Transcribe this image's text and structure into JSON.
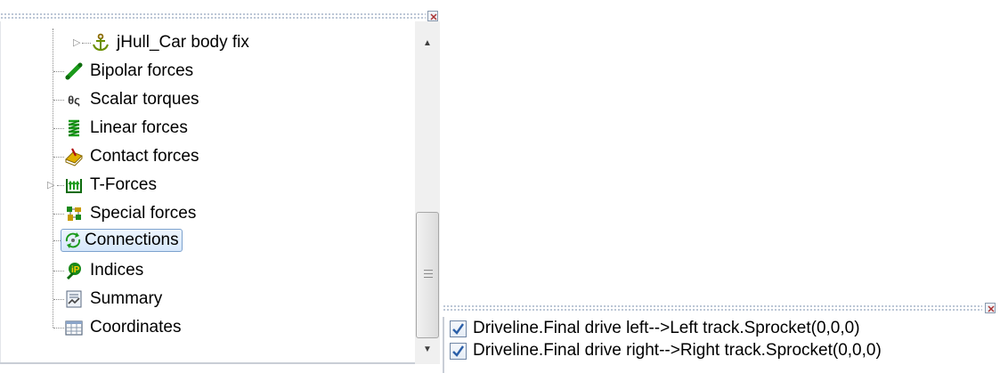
{
  "tree": {
    "items": [
      {
        "label": "jHull_Car body fix",
        "icon": "anchor-icon",
        "expandable": true,
        "selected": false
      },
      {
        "label": "Bipolar forces",
        "icon": "bipolar-forces-icon",
        "expandable": false,
        "selected": false
      },
      {
        "label": "Scalar torques",
        "icon": "scalar-torques-icon",
        "expandable": false,
        "selected": false
      },
      {
        "label": "Linear forces",
        "icon": "spring-icon",
        "expandable": false,
        "selected": false
      },
      {
        "label": "Contact forces",
        "icon": "contact-forces-icon",
        "expandable": false,
        "selected": false
      },
      {
        "label": "T-Forces",
        "icon": "t-forces-icon",
        "expandable": true,
        "selected": false
      },
      {
        "label": "Special forces",
        "icon": "special-forces-icon",
        "expandable": false,
        "selected": false
      },
      {
        "label": "Connections",
        "icon": "connections-icon",
        "expandable": false,
        "selected": true
      },
      {
        "label": "Indices",
        "icon": "indices-icon",
        "expandable": false,
        "selected": false
      },
      {
        "label": "Summary",
        "icon": "summary-icon",
        "expandable": false,
        "selected": false
      },
      {
        "label": "Coordinates",
        "icon": "table-icon",
        "expandable": false,
        "selected": false
      }
    ],
    "icon_glyphs": {
      "scalar_torques": "θς"
    }
  },
  "scrollbar": {
    "up_arrow": "▲",
    "down_arrow": "▼",
    "position_fraction": 0.62
  },
  "connections": {
    "items": [
      {
        "label": "Driveline.Final drive left-->Left track.Sprocket(0,0,0)",
        "checked": true
      },
      {
        "label": "Driveline.Final drive right-->Right track.Sprocket(0,0,0)",
        "checked": true
      }
    ]
  },
  "colors": {
    "selection_border": "#7da2ce",
    "selection_fill": "#d6e7fb",
    "checkmark": "#2b5fa8"
  }
}
